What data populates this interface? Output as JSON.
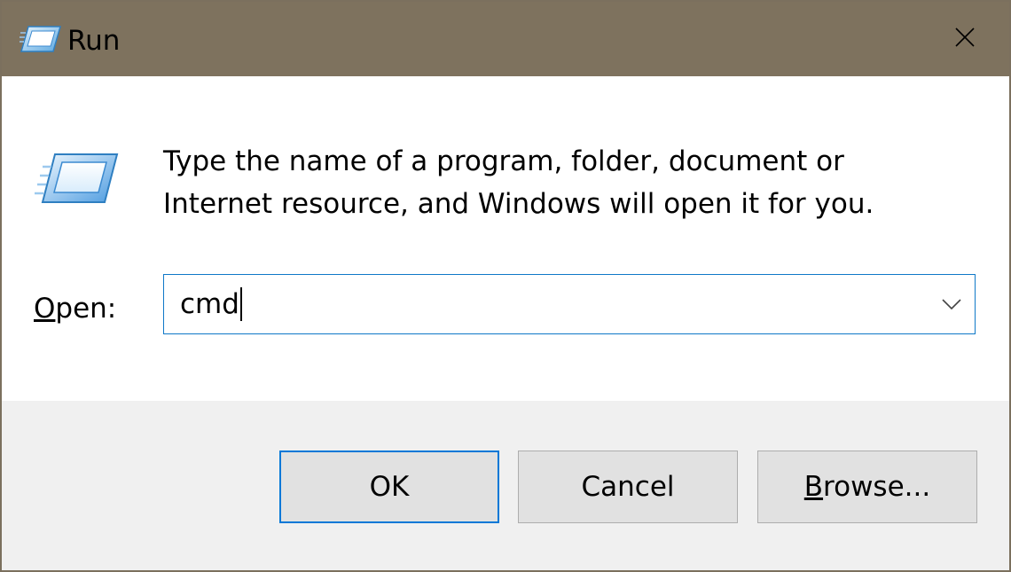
{
  "window": {
    "title": "Run",
    "title_icon": "run-icon",
    "close_icon": "close-icon"
  },
  "content": {
    "icon": "run-icon",
    "description_line1": "Type the name of a program, folder, document or",
    "description_line2": "Internet resource, and Windows will open it for you."
  },
  "open_field": {
    "label_accel": "O",
    "label_rest": "pen:",
    "value": "cmd",
    "dropdown_icon": "chevron-down-icon"
  },
  "buttons": {
    "ok_label": "OK",
    "cancel_label": "Cancel",
    "browse_accel": "B",
    "browse_rest": "rowse..."
  },
  "colors": {
    "titlebar": "#7e725e",
    "focus_blue": "#0078d7",
    "footer": "#f0f0f0",
    "button_face": "#e1e1e1"
  }
}
